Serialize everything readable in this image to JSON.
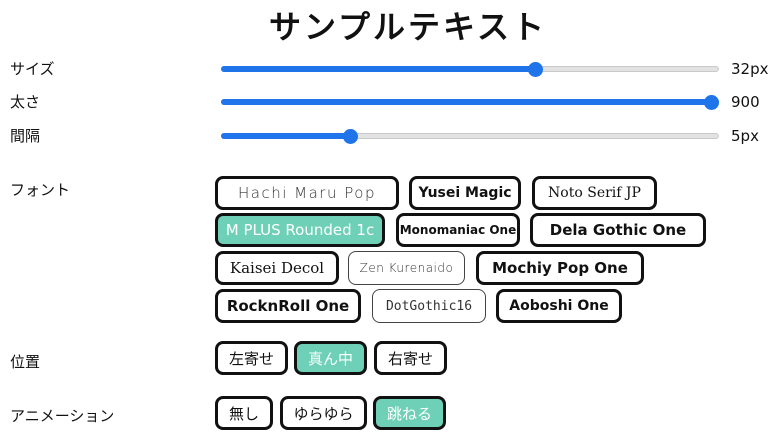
{
  "sample_text": "サンプルテキスト",
  "sliders": {
    "size": {
      "label": "サイズ",
      "value_text": "32px",
      "fraction": 0.63
    },
    "weight": {
      "label": "太さ",
      "value_text": "900",
      "fraction": 1.0
    },
    "spacing": {
      "label": "間隔",
      "value_text": "5px",
      "fraction": 0.26
    }
  },
  "font": {
    "label": "フォント",
    "options": [
      "Hachi Maru Pop",
      "Yusei Magic",
      "Noto Serif JP",
      "M PLUS Rounded 1c",
      "Monomaniac One",
      "Dela Gothic One",
      "Kaisei Decol",
      "Zen Kurenaido",
      "Mochiy Pop One",
      "RocknRoll One",
      "DotGothic16",
      "Aoboshi One"
    ],
    "selected": "M PLUS Rounded 1c"
  },
  "position": {
    "label": "位置",
    "options": [
      "左寄せ",
      "真ん中",
      "右寄せ"
    ],
    "selected": "真ん中"
  },
  "animation": {
    "label": "アニメーション",
    "options": [
      "無し",
      "ゆらゆら",
      "跳ねる"
    ],
    "selected": "跳ねる"
  },
  "colors": {
    "accent": "#1e74e8",
    "selected_chip": "#6fd0b8",
    "chip_border": "#111111"
  }
}
